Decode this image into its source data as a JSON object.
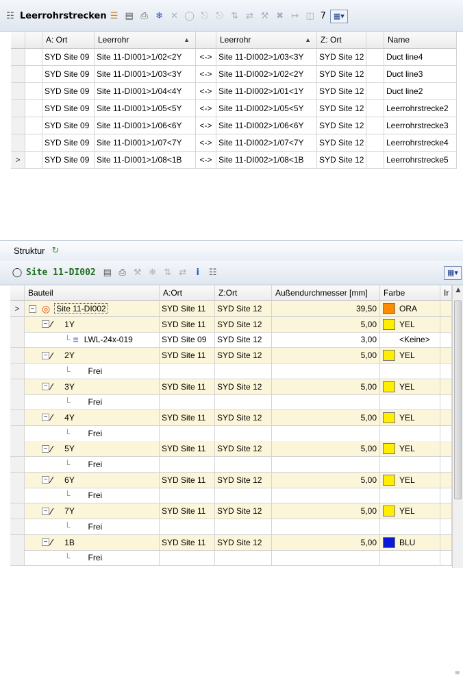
{
  "top_toolbar": {
    "title": "Leerrohrstrecken",
    "count": "7",
    "icons": [
      "duct-route-icon",
      "properties-icon",
      "measure-icon",
      "print-icon",
      "snowflake-icon",
      "delete-icon",
      "duct-icon",
      "connect-icon",
      "disconnect-icon",
      "split-icon",
      "join-icon",
      "tool-icon",
      "cut-icon",
      "arrow-route-icon",
      "count-icon",
      "grid-view-icon"
    ]
  },
  "top_grid": {
    "columns": [
      "A: Ort",
      "Leerrohr",
      "",
      "Leerrohr",
      "Z: Ort",
      "Name"
    ],
    "rows": [
      {
        "marker": "",
        "a_ort": "SYD Site 09",
        "leerrohr_a": "Site 11-DI001>1/02<2Y",
        "sep": "<->",
        "leerrohr_z": "Site 11-DI002>1/03<3Y",
        "z_ort": "SYD Site 12",
        "name": "Duct line4"
      },
      {
        "marker": "",
        "a_ort": "SYD Site 09",
        "leerrohr_a": "Site 11-DI001>1/03<3Y",
        "sep": "<->",
        "leerrohr_z": "Site 11-DI002>1/02<2Y",
        "z_ort": "SYD Site 12",
        "name": "Duct line3"
      },
      {
        "marker": "",
        "a_ort": "SYD Site 09",
        "leerrohr_a": "Site 11-DI001>1/04<4Y",
        "sep": "<->",
        "leerrohr_z": "Site 11-DI002>1/01<1Y",
        "z_ort": "SYD Site 12",
        "name": "Duct line2"
      },
      {
        "marker": "",
        "a_ort": "SYD Site 09",
        "leerrohr_a": "Site 11-DI001>1/05<5Y",
        "sep": "<->",
        "leerrohr_z": "Site 11-DI002>1/05<5Y",
        "z_ort": "SYD Site 12",
        "name": "Leerrohrstrecke2"
      },
      {
        "marker": "",
        "a_ort": "SYD Site 09",
        "leerrohr_a": "Site 11-DI001>1/06<6Y",
        "sep": "<->",
        "leerrohr_z": "Site 11-DI002>1/06<6Y",
        "z_ort": "SYD Site 12",
        "name": "Leerrohrstrecke3"
      },
      {
        "marker": "",
        "a_ort": "SYD Site 09",
        "leerrohr_a": "Site 11-DI001>1/07<7Y",
        "sep": "<->",
        "leerrohr_z": "Site 11-DI002>1/07<7Y",
        "z_ort": "SYD Site 12",
        "name": "Leerrohrstrecke4"
      },
      {
        "marker": ">",
        "a_ort": "SYD Site 09",
        "leerrohr_a": "Site 11-DI001>1/08<1B",
        "sep": "<->",
        "leerrohr_z": "Site 11-DI002>1/08<1B",
        "z_ort": "SYD Site 12",
        "name": "Leerrohrstrecke5"
      }
    ]
  },
  "structure_bar": {
    "label": "Struktur"
  },
  "tree_toolbar": {
    "title": "Site 11-DI002"
  },
  "tree_grid": {
    "columns": [
      "Bauteil",
      "A:Ort",
      "Z:Ort",
      "Außendurchmesser [mm]",
      "Farbe",
      "Ir"
    ],
    "rows": [
      {
        "kind": "site",
        "marker": ">",
        "label": "Site 11-DI002",
        "a_ort": "SYD Site 11",
        "z_ort": "SYD Site 12",
        "diameter": "39,50",
        "color": "#ff8c00",
        "farbe": "ORA"
      },
      {
        "kind": "duct",
        "label": "1Y",
        "a_ort": "SYD Site 11",
        "z_ort": "SYD Site 12",
        "diameter": "5,00",
        "color": "#ffee00",
        "farbe": "YEL"
      },
      {
        "kind": "cable",
        "label": "LWL-24x-019",
        "a_ort": "SYD Site 09",
        "z_ort": "SYD Site 12",
        "diameter": "3,00",
        "color": "",
        "farbe": "<Keine>"
      },
      {
        "kind": "duct",
        "label": "2Y",
        "a_ort": "SYD Site 11",
        "z_ort": "SYD Site 12",
        "diameter": "5,00",
        "color": "#ffee00",
        "farbe": "YEL"
      },
      {
        "kind": "free",
        "label": "Frei",
        "a_ort": "",
        "z_ort": "",
        "diameter": "",
        "color": "",
        "farbe": ""
      },
      {
        "kind": "duct",
        "label": "3Y",
        "a_ort": "SYD Site 11",
        "z_ort": "SYD Site 12",
        "diameter": "5,00",
        "color": "#ffee00",
        "farbe": "YEL"
      },
      {
        "kind": "free",
        "label": "Frei",
        "a_ort": "",
        "z_ort": "",
        "diameter": "",
        "color": "",
        "farbe": ""
      },
      {
        "kind": "duct",
        "label": "4Y",
        "a_ort": "SYD Site 11",
        "z_ort": "SYD Site 12",
        "diameter": "5,00",
        "color": "#ffee00",
        "farbe": "YEL"
      },
      {
        "kind": "free",
        "label": "Frei",
        "a_ort": "",
        "z_ort": "",
        "diameter": "",
        "color": "",
        "farbe": ""
      },
      {
        "kind": "duct",
        "label": "5Y",
        "a_ort": "SYD Site 11",
        "z_ort": "SYD Site 12",
        "diameter": "5,00",
        "color": "#ffee00",
        "farbe": "YEL"
      },
      {
        "kind": "free",
        "label": "Frei",
        "a_ort": "",
        "z_ort": "",
        "diameter": "",
        "color": "",
        "farbe": ""
      },
      {
        "kind": "duct",
        "label": "6Y",
        "a_ort": "SYD Site 11",
        "z_ort": "SYD Site 12",
        "diameter": "5,00",
        "color": "#ffee00",
        "farbe": "YEL"
      },
      {
        "kind": "free",
        "label": "Frei",
        "a_ort": "",
        "z_ort": "",
        "diameter": "",
        "color": "",
        "farbe": ""
      },
      {
        "kind": "duct",
        "label": "7Y",
        "a_ort": "SYD Site 11",
        "z_ort": "SYD Site 12",
        "diameter": "5,00",
        "color": "#ffee00",
        "farbe": "YEL"
      },
      {
        "kind": "free",
        "label": "Frei",
        "a_ort": "",
        "z_ort": "",
        "diameter": "",
        "color": "",
        "farbe": ""
      },
      {
        "kind": "duct",
        "label": "1B",
        "a_ort": "SYD Site 11",
        "z_ort": "SYD Site 12",
        "diameter": "5,00",
        "color": "#0a1ad8",
        "farbe": "BLU"
      },
      {
        "kind": "free",
        "label": "Frei",
        "a_ort": "",
        "z_ort": "",
        "diameter": "",
        "color": "",
        "farbe": ""
      }
    ]
  }
}
